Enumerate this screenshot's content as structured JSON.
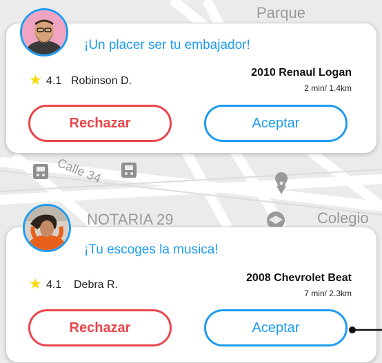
{
  "map": {
    "labels": {
      "parque": "Parque",
      "calle": "Calle 34",
      "notaria": "NOTARIA 29",
      "colegio": "Colegio"
    }
  },
  "colors": {
    "accent": "#1e9bf0",
    "reject": "#e9454b",
    "star": "#f5d90c"
  },
  "cards": [
    {
      "greeting": "¡Un placer ser tu embajador!",
      "rating": "4.1",
      "driver": "Robinson D.",
      "car": "2010 Renaul Logan",
      "eta": "2 min/ 1.4km",
      "reject_label": "Rechazar",
      "accept_label": "Aceptar"
    },
    {
      "greeting": "¡Tu escoges la musica!",
      "rating": "4.1",
      "driver": "Debra R.",
      "car": "2008 Chevrolet Beat",
      "eta": "7 min/ 2.3km",
      "reject_label": "Rechazar",
      "accept_label": "Aceptar"
    }
  ]
}
